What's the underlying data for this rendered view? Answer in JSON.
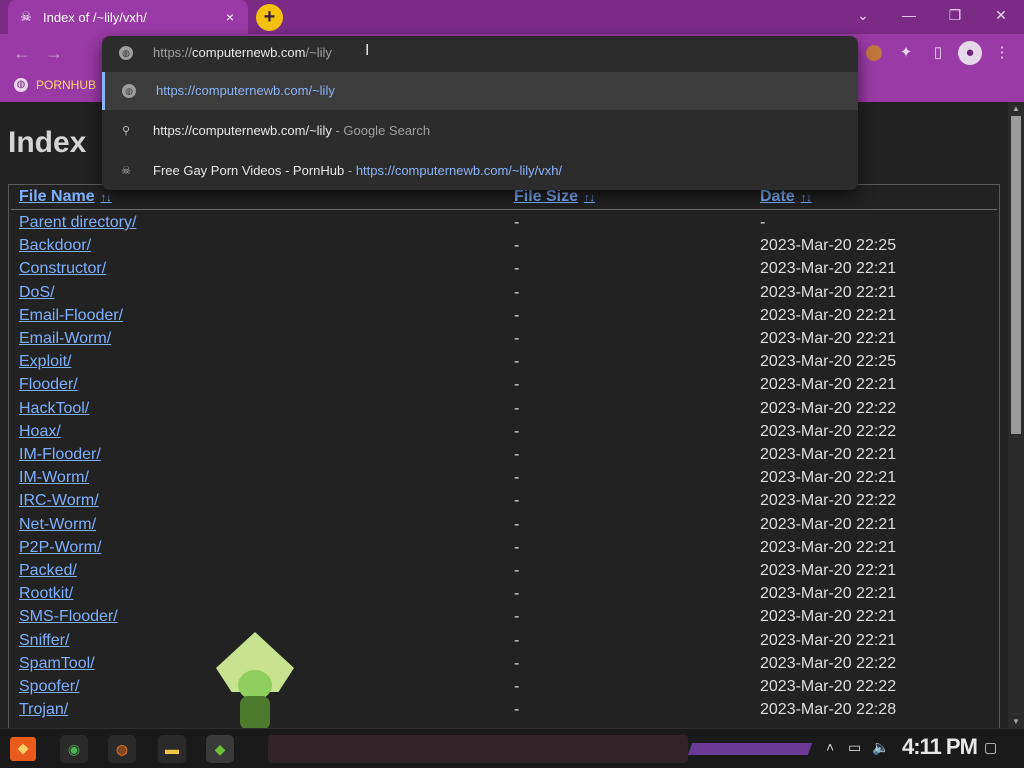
{
  "browser": {
    "tab_title": "Index of /~lily/vxh/",
    "tab_close": "×",
    "new_tab": "+",
    "bookmark_label": "PORNHUB"
  },
  "omnibox": {
    "value_prefix": "https://",
    "value_main": "computernewb.com",
    "value_suffix": "/~lily",
    "suggestions": [
      {
        "text": "https://computernewb.com/~lily",
        "kind": "url"
      },
      {
        "text": "https://computernewb.com/~lily",
        "suffix": " - Google Search",
        "kind": "search"
      },
      {
        "text": "Free Gay Porn Videos - PornHub",
        "sep": " - ",
        "link": "https://computernewb.com/~lily/vxh/",
        "kind": "history"
      }
    ]
  },
  "page": {
    "heading": "Index",
    "columns": {
      "name": "File Name",
      "size": "File Size",
      "date": "Date",
      "sort_arrows": "↑↓"
    },
    "rows": [
      {
        "name": "Parent directory/",
        "size": "-",
        "date": "-"
      },
      {
        "name": "Backdoor/",
        "size": "-",
        "date": "2023-Mar-20 22:25"
      },
      {
        "name": "Constructor/",
        "size": "-",
        "date": "2023-Mar-20 22:21"
      },
      {
        "name": "DoS/",
        "size": "-",
        "date": "2023-Mar-20 22:21"
      },
      {
        "name": "Email-Flooder/",
        "size": "-",
        "date": "2023-Mar-20 22:21"
      },
      {
        "name": "Email-Worm/",
        "size": "-",
        "date": "2023-Mar-20 22:21"
      },
      {
        "name": "Exploit/",
        "size": "-",
        "date": "2023-Mar-20 22:25"
      },
      {
        "name": "Flooder/",
        "size": "-",
        "date": "2023-Mar-20 22:21"
      },
      {
        "name": "HackTool/",
        "size": "-",
        "date": "2023-Mar-20 22:22"
      },
      {
        "name": "Hoax/",
        "size": "-",
        "date": "2023-Mar-20 22:22"
      },
      {
        "name": "IM-Flooder/",
        "size": "-",
        "date": "2023-Mar-20 22:21"
      },
      {
        "name": "IM-Worm/",
        "size": "-",
        "date": "2023-Mar-20 22:21"
      },
      {
        "name": "IRC-Worm/",
        "size": "-",
        "date": "2023-Mar-20 22:22"
      },
      {
        "name": "Net-Worm/",
        "size": "-",
        "date": "2023-Mar-20 22:21"
      },
      {
        "name": "P2P-Worm/",
        "size": "-",
        "date": "2023-Mar-20 22:21"
      },
      {
        "name": "Packed/",
        "size": "-",
        "date": "2023-Mar-20 22:21"
      },
      {
        "name": "Rootkit/",
        "size": "-",
        "date": "2023-Mar-20 22:21"
      },
      {
        "name": "SMS-Flooder/",
        "size": "-",
        "date": "2023-Mar-20 22:21"
      },
      {
        "name": "Sniffer/",
        "size": "-",
        "date": "2023-Mar-20 22:21"
      },
      {
        "name": "SpamTool/",
        "size": "-",
        "date": "2023-Mar-20 22:22"
      },
      {
        "name": "Spoofer/",
        "size": "-",
        "date": "2023-Mar-20 22:22"
      },
      {
        "name": "Trojan/",
        "size": "-",
        "date": "2023-Mar-20 22:28"
      }
    ]
  },
  "taskbar": {
    "clock": "4:11 PM"
  },
  "colors": {
    "accent": "#9a3aa6",
    "titlebar": "#7b2a86",
    "link": "#7eb0ff",
    "omnibox_link": "#8ab4f8"
  }
}
